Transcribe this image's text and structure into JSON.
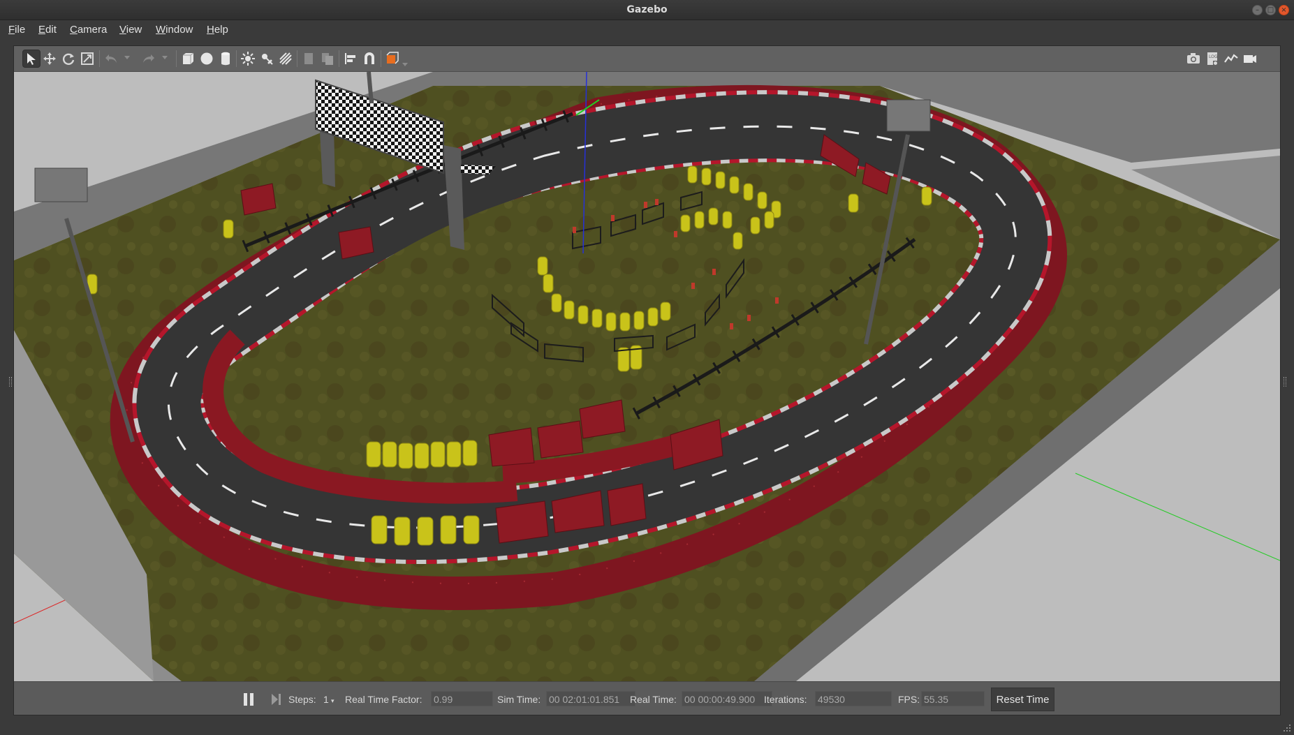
{
  "window": {
    "title": "Gazebo"
  },
  "menu": [
    "File",
    "Edit",
    "Camera",
    "View",
    "Window",
    "Help"
  ],
  "toolbar": {
    "left_tools": [
      "select-mode",
      "translate-mode",
      "rotate-mode",
      "scale-mode",
      "undo",
      "redo",
      "box-shape",
      "sphere-shape",
      "cylinder-shape",
      "point-light",
      "spot-light",
      "directional-light",
      "copy",
      "paste",
      "align",
      "snap",
      "change-view"
    ],
    "right_tools": [
      "screenshot",
      "log",
      "plot",
      "record-video"
    ]
  },
  "bottom": {
    "steps_label": "Steps:",
    "steps_value": "1",
    "rtf_label": "Real Time Factor:",
    "rtf_value": "0.99",
    "sim_time_label": "Sim Time:",
    "sim_time_value": "00 02:01:01.851",
    "real_time_label": "Real Time:",
    "real_time_value": "00 00:00:49.900",
    "iterations_label": "Iterations:",
    "iterations_value": "49530",
    "fps_label": "FPS:",
    "fps_value": "55.35",
    "reset_label": "Reset Time"
  },
  "colors": {
    "grass": "#4f5021",
    "track": "#3a3a3a",
    "barrier": "#8e1a24",
    "barrel": "#c9c31a",
    "wall": "#8a8a8a",
    "ground": "#bdbdbd"
  }
}
